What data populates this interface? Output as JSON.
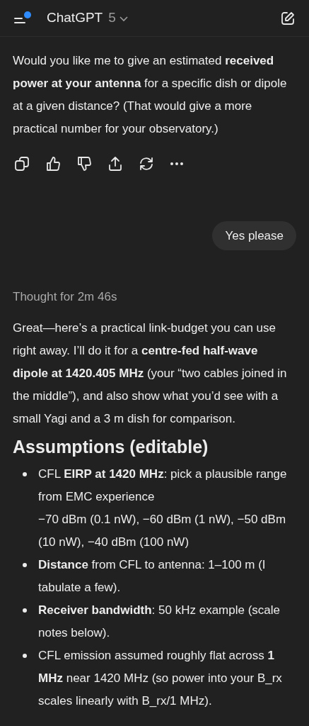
{
  "header": {
    "title": "ChatGPT",
    "model": "5",
    "has_notification": true
  },
  "assistant_message": {
    "text": "Would you like me to give an estimated **received power at your antenna** for a specific dish or dipole at a given distance? (That would give a more practical number for your observatory.)"
  },
  "actions": [
    {
      "kind": "copy"
    },
    {
      "kind": "like"
    },
    {
      "kind": "dislike"
    },
    {
      "kind": "share"
    },
    {
      "kind": "regenerate"
    },
    {
      "kind": "more"
    }
  ],
  "user_message": {
    "text": "Yes please"
  },
  "thought": {
    "text": "Thought for 2m 46s"
  },
  "reply": {
    "intro": "Great—here’s a practical link-budget you can use right away. I’ll do it for a **centre-fed half-wave dipole at 1420.405 MHz** (your “two cables joined in the middle”), and also show what you’d see with a small Yagi and a 3 m dish for comparison.",
    "heading": "Assumptions (editable)",
    "bullets": [
      {
        "text": "CFL **EIRP at 1420 MHz**: pick a plausible range from EMC experience\n−70 dBm (0.1 nW), −60 dBm (1 nW), −50 dBm (10 nW), −40 dBm (100 nW)"
      },
      {
        "text": "**Distance** from CFL to antenna: 1–100 m (I tabulate a few)."
      },
      {
        "text": "**Receiver bandwidth**: 50 kHz example (scale notes below)."
      },
      {
        "text": "CFL emission assumed roughly flat across **1 MHz** near 1420 MHz (so power into your B_rx scales linearly with B_rx/1 MHz)."
      }
    ]
  }
}
